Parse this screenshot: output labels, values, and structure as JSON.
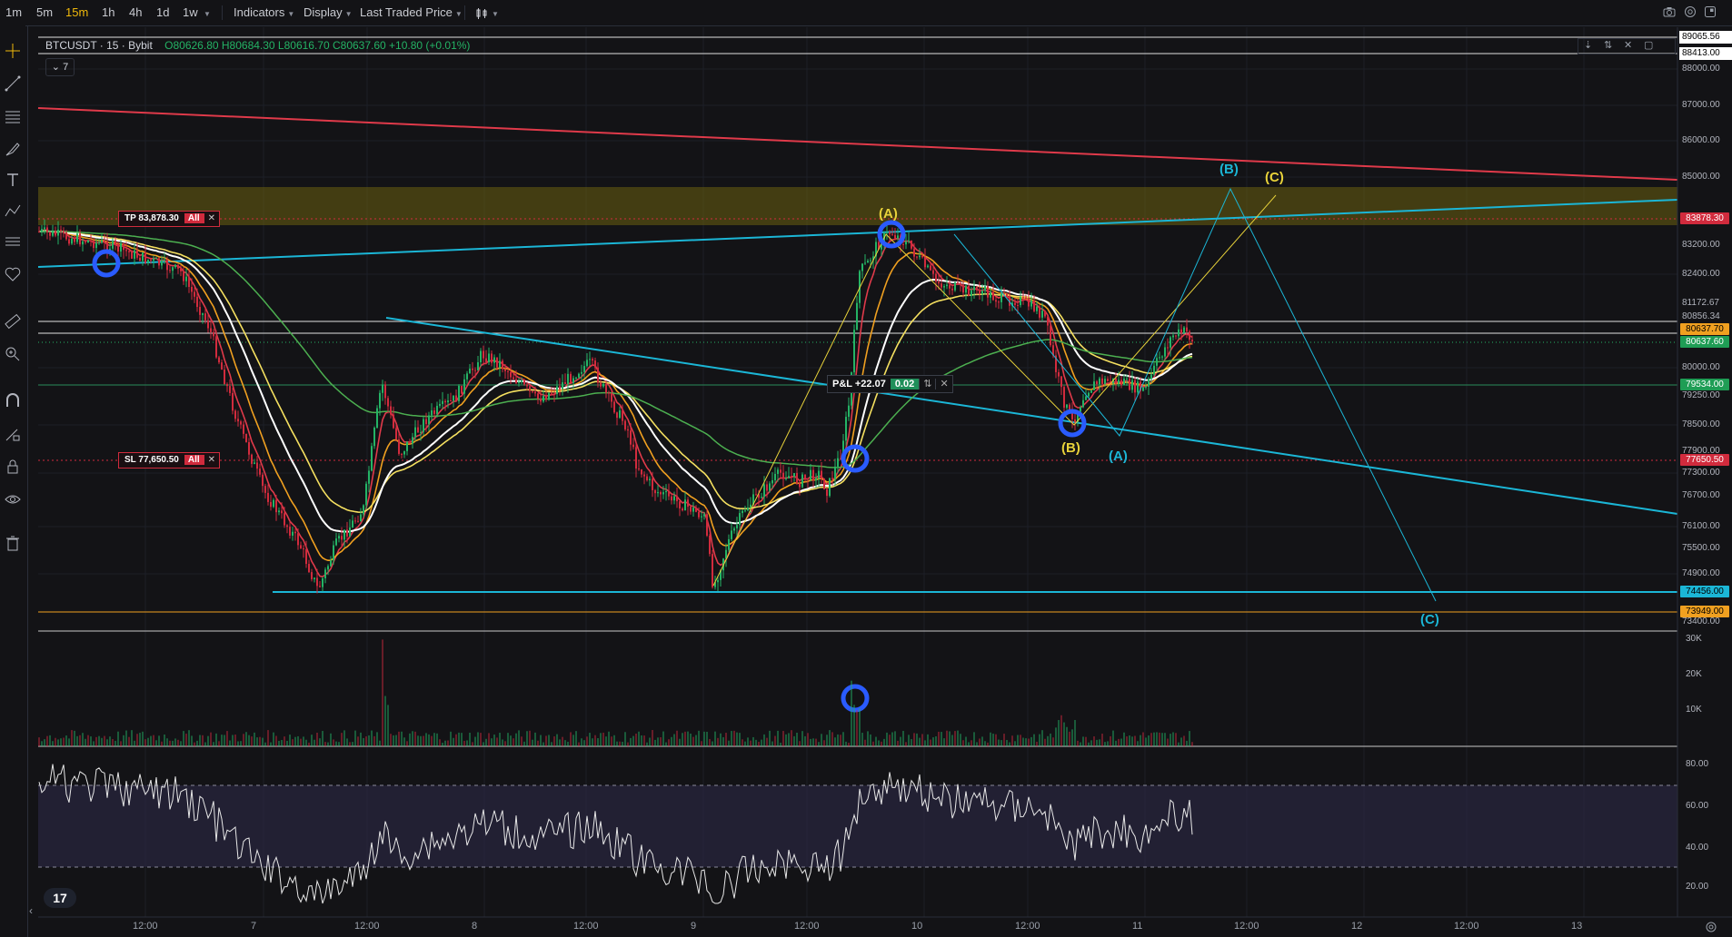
{
  "topbar": {
    "intervals": [
      "1m",
      "5m",
      "15m",
      "1h",
      "4h",
      "1d",
      "1w"
    ],
    "active_interval": "15m",
    "indicators_label": "Indicators",
    "display_label": "Display",
    "price_type_label": "Last Traded Price",
    "chart_type_icon": "candles-icon",
    "right_icons": [
      "camera-icon",
      "settings-icon",
      "fullscreen-icon"
    ]
  },
  "left_toolbar": {
    "tools": [
      "crosshair-icon",
      "trendline-icon",
      "fib-retracement-icon",
      "brush-icon",
      "text-icon",
      "pattern-icon",
      "forecast-icon",
      "favorites-icon",
      "ruler-icon",
      "zoom-icon",
      "magnet-icon",
      "lock-drawing-icon",
      "lock-icon",
      "eye-icon",
      "trash-icon"
    ]
  },
  "legend": {
    "symbol": "BTCUSDT · 15 · Bybit",
    "ohlc": "O80626.80 H80684.30 L80616.70 C80637.60 +10.80 (+0.01%)",
    "collapse_label": "7"
  },
  "price_axis": {
    "labels": [
      "89065.56",
      "88413.00",
      "88000.00",
      "87000.00",
      "86000.00",
      "85000.00",
      "83200.00",
      "82400.00",
      "81172.67",
      "80856.34",
      "80000.00",
      "79250.00",
      "78500.00",
      "77900.00",
      "77300.00",
      "76700.00",
      "76100.00",
      "75500.00",
      "74900.00",
      "73400.00"
    ],
    "tags": [
      {
        "value": "83878.30",
        "color": "#d12b3d"
      },
      {
        "value": "80637.70",
        "color": "#f0a020"
      },
      {
        "value": "80637.60",
        "color": "#1f9d55"
      },
      {
        "value": "79534.00",
        "color": "#1f9d55"
      },
      {
        "value": "77650.50",
        "color": "#d12b3d"
      },
      {
        "value": "74456.00",
        "color": "#1bb6d6"
      },
      {
        "value": "73949.00",
        "color": "#f0a020"
      }
    ]
  },
  "volume_axis": [
    "30K",
    "20K",
    "10K"
  ],
  "rsi_axis": [
    "80.00",
    "60.00",
    "40.00",
    "20.00"
  ],
  "time_axis": [
    "12:00",
    "7",
    "12:00",
    "8",
    "12:00",
    "9",
    "12:00",
    "10",
    "12:00",
    "11",
    "12:00",
    "12",
    "12:00",
    "13"
  ],
  "orders": {
    "tp_label": "TP 83,878.30",
    "sl_label": "SL 77,650.50",
    "all_label": "All",
    "close_glyph": "✕"
  },
  "position": {
    "pnl_label": "P&L +22.07",
    "qty": "0.02",
    "reverse_glyph": "⇅",
    "close_glyph": "✕"
  },
  "waves": {
    "yellow": [
      "(A)",
      "(B)",
      "(C)"
    ],
    "cyan": [
      "(A)",
      "(B)",
      "(C)"
    ]
  },
  "colors": {
    "background": "#131316",
    "up": "#24b365",
    "down": "#d12b3d",
    "accent": "#f0b90b",
    "cyan": "#1bb6d6"
  },
  "logo_text": "17"
}
